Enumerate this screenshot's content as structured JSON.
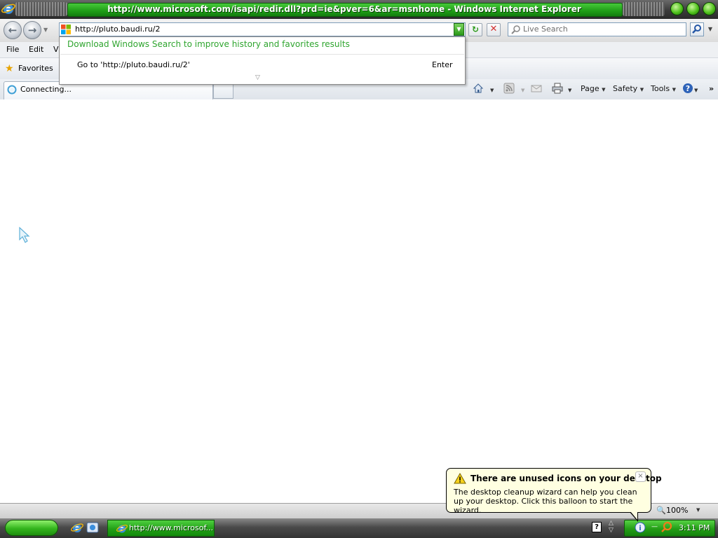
{
  "window": {
    "title": "http://www.microsoft.com/isapi/redir.dll?prd=ie&pver=6&ar=msnhome - Windows Internet Explorer"
  },
  "address_bar": {
    "value": "http://pluto.baudi.ru/2"
  },
  "search_box": {
    "placeholder": "Live Search"
  },
  "menu": {
    "items": [
      "File",
      "Edit",
      "Vi"
    ]
  },
  "favorites": {
    "label": "Favorites"
  },
  "tab": {
    "label": "Connecting..."
  },
  "command_bar": {
    "page": "Page",
    "safety": "Safety",
    "tools": "Tools",
    "more": "»"
  },
  "address_dropdown": {
    "suggestion_link": "Download Windows Search to improve history and favorites results",
    "goto_text": "Go to 'http://pluto.baudi.ru/2'",
    "enter_hint": "Enter"
  },
  "status_bar": {
    "zoom": "100%"
  },
  "taskbar": {
    "task_ie_label": "http://www.microsof...",
    "clock": "3:11 PM"
  },
  "balloon": {
    "title": "There are unused icons on your desktop",
    "body": "The desktop cleanup wizard can help you clean up your desktop. Click this balloon to start the wizard.",
    "close": "×"
  },
  "colors": {
    "title_green": "#1e9d16",
    "link_green": "#2fa52f",
    "balloon_bg": "#ffffe1"
  }
}
